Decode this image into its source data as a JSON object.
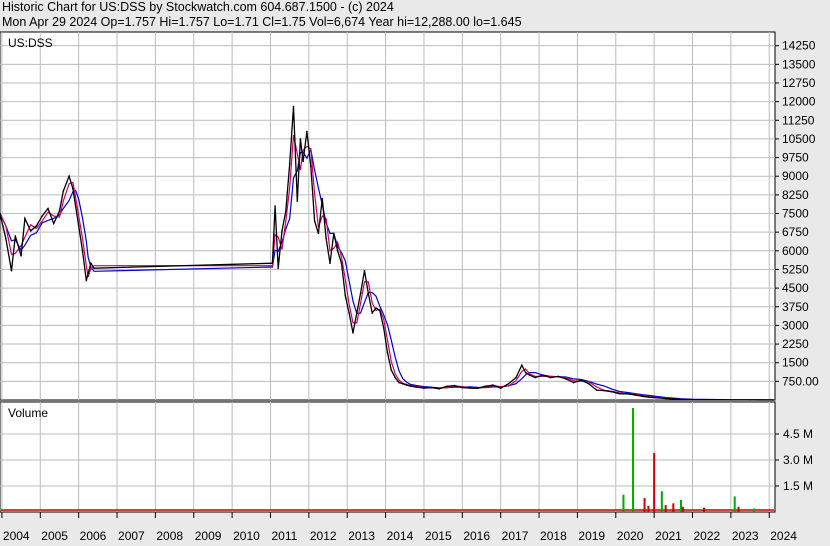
{
  "header": {
    "line1": "Historic Chart for US:DSS by Stockwatch.com 604.687.1500 - (c) 2024",
    "line2": "Mon Apr 29 2024   Op=1.757  Hi=1.757  Lo=1.71  Cl=1.75  Vol=6,674  Year hi=12,288.00  lo=1.645"
  },
  "colors": {
    "price": "#000000",
    "ma_short": "#cc0066",
    "ma_long": "#0000cc",
    "vol_up": "#00aa00",
    "vol_down": "#cc0000",
    "grid": "#bbbbbb",
    "background": "#ffffff",
    "frame_bg": "#e9e9e9"
  },
  "chart_data": [
    {
      "type": "line",
      "title": "US:DSS",
      "ylim": [
        0,
        14800
      ],
      "y_ticks": [
        750,
        1500,
        2250,
        3000,
        3750,
        4500,
        5250,
        6000,
        6750,
        7500,
        8250,
        9000,
        9750,
        10500,
        11250,
        12000,
        12750,
        13500,
        14250
      ],
      "y_tick_labels": [
        "750.00",
        "1500",
        "2250",
        "3000",
        "3750",
        "4500",
        "5250",
        "6000",
        "6750",
        "7500",
        "8250",
        "9000",
        "9750",
        "10500",
        "11250",
        "12000",
        "12750",
        "13500",
        "14250"
      ],
      "x_range": [
        2003.95,
        2024.15
      ],
      "x_ticks": [
        2004,
        2005,
        2006,
        2007,
        2008,
        2009,
        2010,
        2011,
        2012,
        2013,
        2014,
        2015,
        2016,
        2017,
        2018,
        2019,
        2020,
        2021,
        2022,
        2023,
        2024
      ],
      "x_tick_labels": [
        "2004",
        "2005",
        "2006",
        "2007",
        "2008",
        "2009",
        "2010",
        "2011",
        "2012",
        "2013",
        "2014",
        "2015",
        "2016",
        "2017",
        "2018",
        "2019",
        "2020",
        "2021",
        "2022",
        "2023",
        "2024"
      ],
      "series": [
        {
          "x": [
            2003.95,
            2004.1,
            2004.25,
            2004.35,
            2004.5,
            2004.6,
            2004.75,
            2004.9,
            2005.05,
            2005.2,
            2005.35,
            2005.5,
            2005.6,
            2005.75,
            2005.85,
            2005.92,
            2006.0,
            2006.1,
            2006.2,
            2006.25,
            2006.32,
            2006.4,
            2011.05,
            2011.12,
            2011.2,
            2011.3,
            2011.4,
            2011.5,
            2011.6,
            2011.7,
            2011.78,
            2011.85,
            2011.95,
            2012.05,
            2012.15,
            2012.25,
            2012.35,
            2012.45,
            2012.55,
            2012.65,
            2012.75,
            2012.85,
            2012.95,
            2013.05,
            2013.15,
            2013.25,
            2013.35,
            2013.45,
            2013.55,
            2013.65,
            2013.75,
            2013.85,
            2013.95,
            2014.05,
            2014.15,
            2014.25,
            2014.35,
            2014.45,
            2014.55,
            2014.65,
            2014.8,
            2015.0,
            2015.2,
            2015.4,
            2015.6,
            2015.8,
            2016.0,
            2016.2,
            2016.4,
            2016.6,
            2016.8,
            2017.0,
            2017.2,
            2017.4,
            2017.55,
            2017.65,
            2017.75,
            2017.9,
            2018.1,
            2018.3,
            2018.5,
            2018.7,
            2018.9,
            2019.1,
            2019.3,
            2019.5,
            2019.7,
            2019.9,
            2020.1,
            2020.3,
            2020.5,
            2020.7,
            2020.9,
            2021.1,
            2021.3,
            2021.5,
            2021.7,
            2022.0,
            2022.5,
            2023.0,
            2023.5,
            2024.1
          ],
          "values": [
            7500,
            6500,
            5200,
            6600,
            5800,
            7300,
            6800,
            7000,
            7400,
            7700,
            7100,
            7600,
            8400,
            9000,
            8500,
            7800,
            7000,
            6000,
            4800,
            5100,
            5500,
            5300,
            5500,
            7800,
            5300,
            6800,
            7600,
            9500,
            11800,
            8000,
            10500,
            9600,
            10800,
            9400,
            7200,
            6700,
            8100,
            6500,
            5500,
            6700,
            6000,
            5500,
            4200,
            3500,
            2700,
            3500,
            4300,
            5200,
            4300,
            3500,
            3700,
            3600,
            2900,
            1900,
            1200,
            900,
            700,
            650,
            600,
            560,
            520,
            480,
            500,
            450,
            550,
            580,
            500,
            480,
            470,
            550,
            600,
            480,
            650,
            900,
            1400,
            1100,
            1000,
            900,
            1000,
            900,
            950,
            850,
            700,
            800,
            650,
            400,
            380,
            330,
            250,
            250,
            200,
            150,
            110,
            90,
            60,
            40,
            20,
            10,
            8,
            5,
            3,
            1.75
          ]
        }
      ]
    },
    {
      "type": "bar",
      "title": "Volume",
      "ylim": [
        0,
        6000000
      ],
      "y_ticks": [
        1500000,
        3000000,
        4500000
      ],
      "y_tick_labels": [
        "1.5 M",
        "3.0 M",
        "4.5 M"
      ],
      "x_range": [
        2003.95,
        2024.15
      ],
      "series": [
        {
          "x": [
            2020.2,
            2020.45,
            2020.75,
            2020.85,
            2021.0,
            2021.2,
            2021.3,
            2021.5,
            2021.7,
            2021.75,
            2023.1,
            2023.6,
            2023.2,
            2022.3
          ],
          "values": [
            1000000,
            6000000,
            800000,
            350000,
            3400000,
            1200000,
            400000,
            500000,
            700000,
            300000,
            900000,
            200000,
            300000,
            250000
          ],
          "colors": [
            "green",
            "green",
            "red",
            "red",
            "red",
            "green",
            "red",
            "red",
            "green",
            "red",
            "green",
            "green",
            "red",
            "red"
          ]
        }
      ]
    }
  ]
}
